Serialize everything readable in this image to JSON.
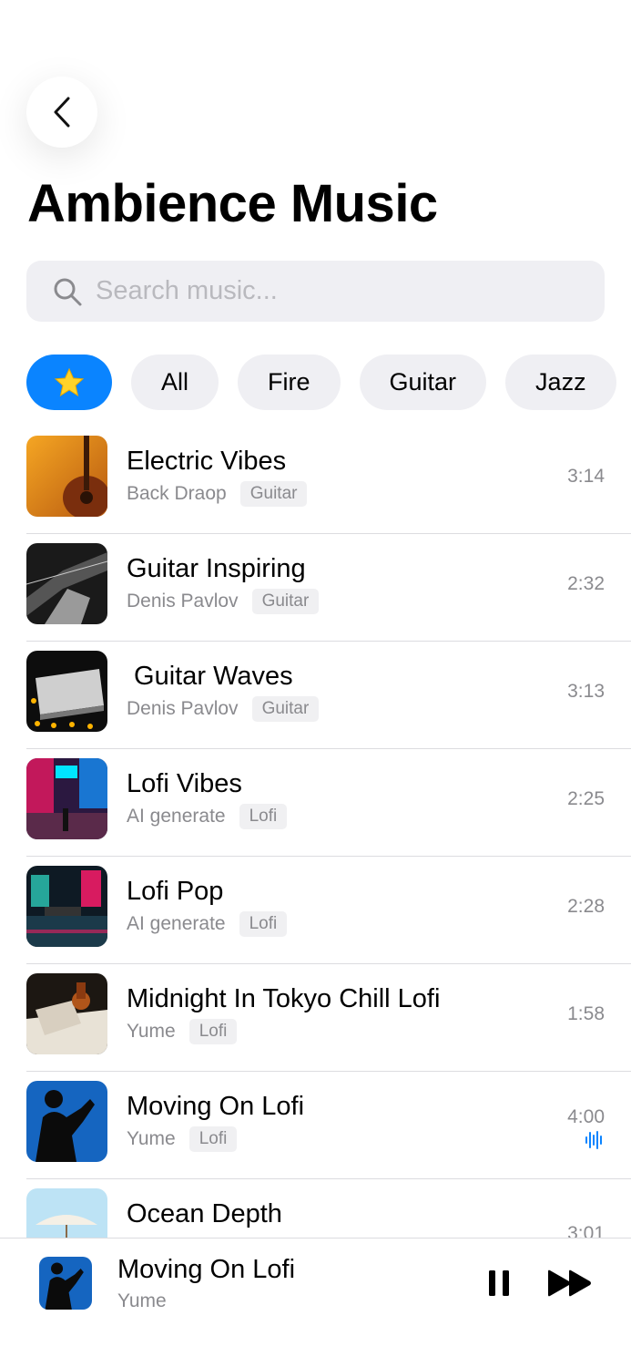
{
  "header": {
    "back_icon": "chevron-left-icon",
    "title": "Ambience Music"
  },
  "search": {
    "placeholder": "Search music...",
    "value": "",
    "icon": "search-icon"
  },
  "filters": {
    "favorites_icon": "star-icon",
    "chips": [
      "All",
      "Fire",
      "Guitar",
      "Jazz"
    ],
    "active": "favorites"
  },
  "tracks": [
    {
      "title": "Electric Vibes",
      "artist": "Back Draop",
      "tag": "Guitar",
      "duration": "3:14"
    },
    {
      "title": "Guitar Inspiring",
      "artist": "Denis Pavlov",
      "tag": "Guitar",
      "duration": "2:32"
    },
    {
      "title": " Guitar Waves",
      "artist": "Denis Pavlov",
      "tag": "Guitar",
      "duration": "3:13"
    },
    {
      "title": "Lofi Vibes",
      "artist": "AI generate",
      "tag": "Lofi",
      "duration": "2:25"
    },
    {
      "title": "Lofi Pop",
      "artist": "AI generate",
      "tag": "Lofi",
      "duration": "2:28"
    },
    {
      "title": "Midnight In Tokyo Chill Lofi",
      "artist": "Yume",
      "tag": "Lofi",
      "duration": "1:58"
    },
    {
      "title": "Moving On Lofi",
      "artist": "Yume",
      "tag": "Lofi",
      "duration": "4:00",
      "playing": true
    },
    {
      "title": "Ocean Depth",
      "artist": "",
      "tag": "",
      "duration": "3:01"
    }
  ],
  "now_playing": {
    "title": "Moving On Lofi",
    "artist": "Yume",
    "pause_icon": "pause-icon",
    "next_icon": "fast-forward-icon"
  },
  "colors": {
    "accent": "#0a84ff",
    "chip_bg": "#efeff3",
    "secondary_text": "#8a8a8e"
  }
}
